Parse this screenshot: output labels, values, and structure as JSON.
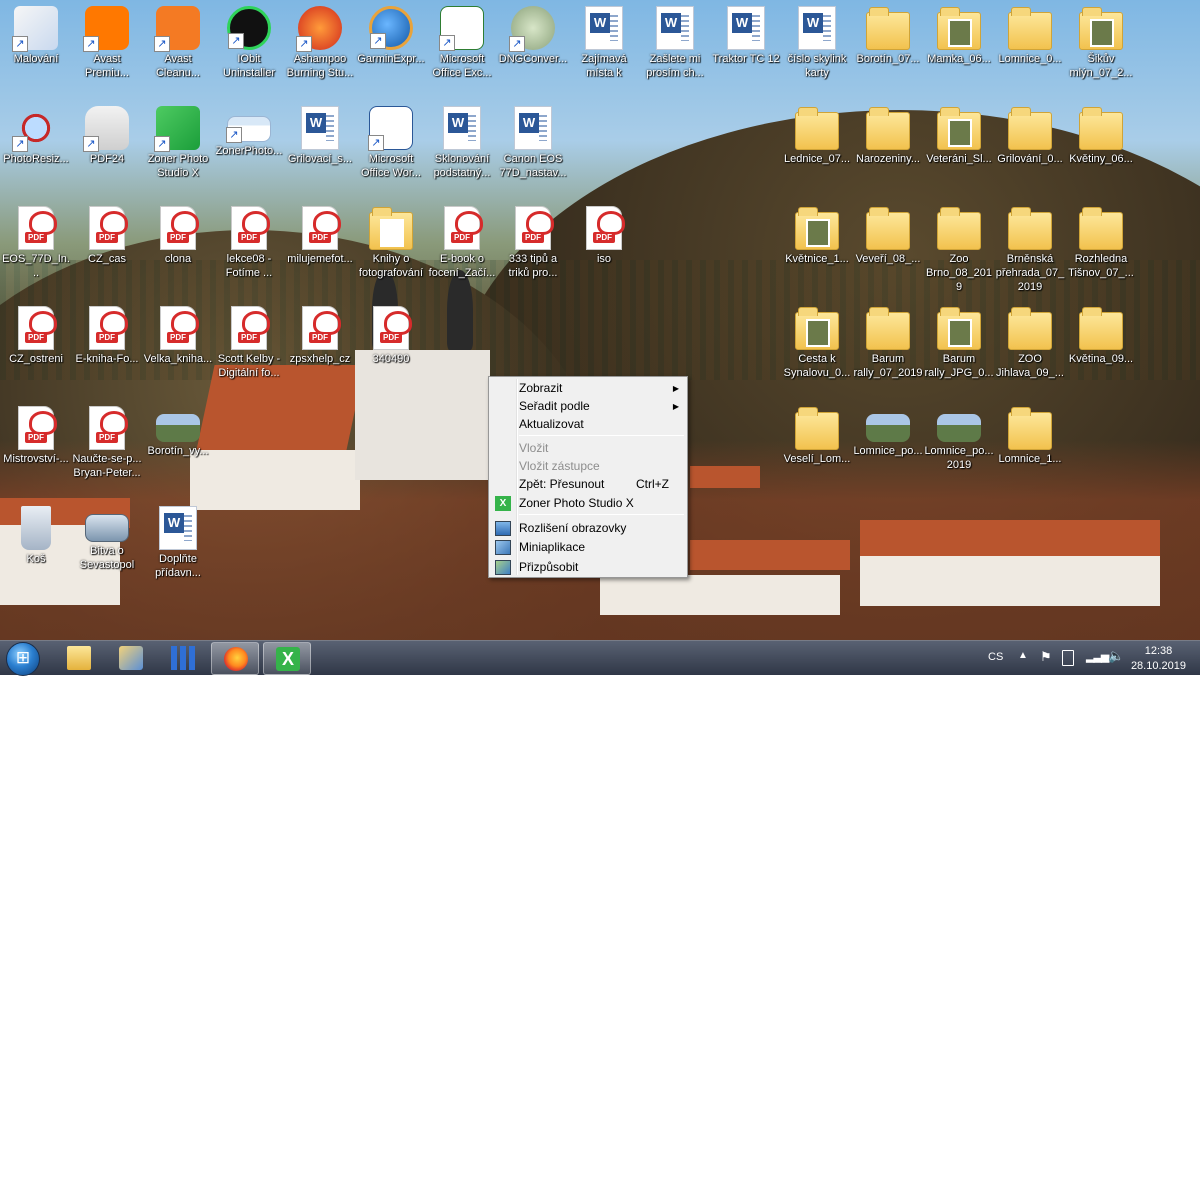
{
  "desktop": {
    "icons": [
      {
        "label": "Malování",
        "kind": "paint"
      },
      {
        "label": "Avast Premiu...",
        "kind": "avast"
      },
      {
        "label": "Avast Cleanu...",
        "kind": "avast-cleanup"
      },
      {
        "label": "IObit Uninstaller",
        "kind": "iobit"
      },
      {
        "label": "Ashampoo Burning Stu...",
        "kind": "ashampoo"
      },
      {
        "label": "GarminExpr...",
        "kind": "garmin"
      },
      {
        "label": "Microsoft Office Exc...",
        "kind": "excel"
      },
      {
        "label": "DNGConver...",
        "kind": "dng"
      },
      {
        "label": "Zajímavá místa k",
        "kind": "word"
      },
      {
        "label": "Zašlete mi prosím ch...",
        "kind": "word"
      },
      {
        "label": "Traktor TC 12",
        "kind": "word"
      },
      {
        "label": "číslo skylink karty",
        "kind": "word"
      },
      {
        "label": "Borotín_07...",
        "kind": "folder"
      },
      {
        "label": "Mamka_06...",
        "kind": "folder-photo"
      },
      {
        "label": "Lomnice_0...",
        "kind": "folder"
      },
      {
        "label": "Šikův mlýn_07_2...",
        "kind": "folder-photo"
      },
      {
        "label": "PhotoResiz...",
        "kind": "photoresize"
      },
      {
        "label": "PDF24",
        "kind": "pdf24"
      },
      {
        "label": "Zoner Photo Studio X",
        "kind": "zoner"
      },
      {
        "label": "ZonerPhoto...",
        "kind": "zoner-shot"
      },
      {
        "label": "Grilovací_s...",
        "kind": "word"
      },
      {
        "label": "Microsoft Office Wor...",
        "kind": "word-app"
      },
      {
        "label": "Sklonování podstatný...",
        "kind": "word"
      },
      {
        "label": "Canon EOS 77D_nastav...",
        "kind": "word"
      },
      {
        "label": "Lednice_07...",
        "kind": "folder"
      },
      {
        "label": "Narozeniny...",
        "kind": "folder"
      },
      {
        "label": "Veteráni_Sl...",
        "kind": "folder-photo"
      },
      {
        "label": "Grilování_0...",
        "kind": "folder"
      },
      {
        "label": "Květiny_06...",
        "kind": "folder"
      },
      {
        "label": "EOS_77D_In...",
        "kind": "pdf"
      },
      {
        "label": "CZ_cas",
        "kind": "pdf"
      },
      {
        "label": "clona",
        "kind": "pdf"
      },
      {
        "label": "lekce08 - Fotíme ...",
        "kind": "pdf"
      },
      {
        "label": "milujemefot...",
        "kind": "pdf"
      },
      {
        "label": "Knihy o fotografování",
        "kind": "folder-pdf"
      },
      {
        "label": "E-book o focení_Začí...",
        "kind": "pdf"
      },
      {
        "label": "333 tipů a triků pro...",
        "kind": "pdf"
      },
      {
        "label": "iso",
        "kind": "pdf"
      },
      {
        "label": "Květnice_1...",
        "kind": "folder-photo"
      },
      {
        "label": "Veveří_08_...",
        "kind": "folder"
      },
      {
        "label": "Zoo Brno_08_2019",
        "kind": "folder"
      },
      {
        "label": "Brněnská přehrada_07_2019",
        "kind": "folder"
      },
      {
        "label": "Rozhledna Tišnov_07_...",
        "kind": "folder"
      },
      {
        "label": "CZ_ostreni",
        "kind": "pdf"
      },
      {
        "label": "E-kniha-Fo...",
        "kind": "pdf"
      },
      {
        "label": "Velka_kniha...",
        "kind": "pdf"
      },
      {
        "label": "Scott Kelby - Digitální fo...",
        "kind": "pdf"
      },
      {
        "label": "zpsxhelp_cz",
        "kind": "pdf"
      },
      {
        "label": "340490",
        "kind": "pdf"
      },
      {
        "label": "Cesta k Synalovu_0...",
        "kind": "folder-photo"
      },
      {
        "label": "Barum rally_07_2019",
        "kind": "folder"
      },
      {
        "label": "Barum rally_JPG_0...",
        "kind": "folder-photo"
      },
      {
        "label": "ZOO Jihlava_09_...",
        "kind": "folder"
      },
      {
        "label": "Květina_09...",
        "kind": "folder"
      },
      {
        "label": "Mistrovství-...",
        "kind": "pdf"
      },
      {
        "label": "Naučte-se-p... Bryan-Peter...",
        "kind": "pdf"
      },
      {
        "label": "Borotín_vy...",
        "kind": "image"
      },
      {
        "label": "Veselí_Lom...",
        "kind": "folder"
      },
      {
        "label": "Lomnice_po...",
        "kind": "image"
      },
      {
        "label": "Lomnice_po... 2019",
        "kind": "image"
      },
      {
        "label": "Lomnice_1...",
        "kind": "folder"
      },
      {
        "label": "Koš",
        "kind": "recycle"
      },
      {
        "label": "Bitva o Sevastopol",
        "kind": "video"
      },
      {
        "label": "Doplňte přídavn...",
        "kind": "word"
      }
    ]
  },
  "context_menu": {
    "items": [
      {
        "label": "Zobrazit",
        "submenu": true,
        "disabled": false
      },
      {
        "label": "Seřadit podle",
        "submenu": true,
        "disabled": false
      },
      {
        "label": "Aktualizovat",
        "submenu": false,
        "disabled": false
      },
      {
        "label": "Vložit",
        "submenu": false,
        "disabled": true
      },
      {
        "label": "Vložit zástupce",
        "submenu": false,
        "disabled": true
      },
      {
        "label": "Zpět: Přesunout",
        "shortcut": "Ctrl+Z",
        "submenu": false,
        "disabled": false
      },
      {
        "label": "Zoner Photo Studio X",
        "submenu": false,
        "disabled": false,
        "icon": "zoner-icon"
      },
      {
        "label": "Rozlišení obrazovky",
        "submenu": false,
        "disabled": false,
        "icon": "display-icon"
      },
      {
        "label": "Miniaplikace",
        "submenu": false,
        "disabled": false,
        "icon": "gadgets-icon"
      },
      {
        "label": "Přizpůsobit",
        "submenu": false,
        "disabled": false,
        "icon": "personalize-icon"
      }
    ]
  },
  "taskbar": {
    "pinned": [
      "explorer",
      "image-viewer",
      "app-blue",
      "firefox",
      "zoner"
    ],
    "language": "CS",
    "clock": {
      "time": "12:38",
      "date": "28.10.2019"
    }
  },
  "colors": {
    "pdf_red": "#d62b2b",
    "folder_yellow": "#f2c24e",
    "word_blue": "#2b5797",
    "menu_bg": "#f0f0f0"
  }
}
